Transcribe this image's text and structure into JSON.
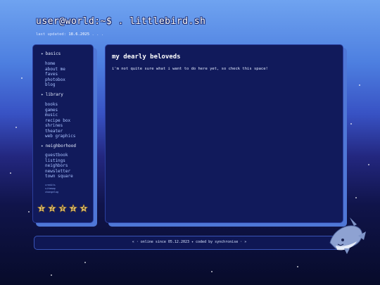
{
  "header": {
    "title": "user@world:~$ . littlebird.sh",
    "last_updated_label": "last updated:",
    "last_updated_date": "18.6.2025",
    "last_updated_suffix": ". . ."
  },
  "sidebar": {
    "sections": [
      {
        "heading": "basics",
        "links": [
          "home",
          "about me",
          "faves",
          "photobox",
          "blog"
        ]
      },
      {
        "heading": "library",
        "links": [
          "books",
          "games",
          "music",
          "recipe box",
          "shrines",
          "theater",
          "web graphics"
        ]
      },
      {
        "heading": "neighborhood",
        "links": [
          "guestbook",
          "listings",
          "neighbors",
          "newsletter",
          "town square"
        ]
      }
    ],
    "mini_links": [
      "credits",
      "sitemap",
      "changelog"
    ],
    "badges": [
      "1",
      "2",
      "0",
      "2",
      "4"
    ]
  },
  "main": {
    "title": "my dearly beloveds",
    "body": "i'm not quite sure what i want to do here yet, so check this space!"
  },
  "footer": {
    "text": "« · online since 05.12.2023 ✦ coded by synchronise · »"
  },
  "colors": {
    "panel_bg": "#111a5b",
    "panel_shadow": "#4f77d6",
    "link": "#a9c2ff",
    "badge_gold": "#e8c878"
  },
  "icons": [
    "diamond-bullet-icon",
    "star-badge-icon",
    "shark-mascot-icon"
  ]
}
